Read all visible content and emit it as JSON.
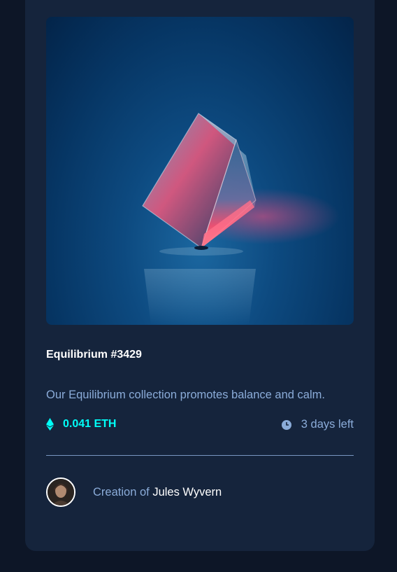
{
  "nft": {
    "title": "Equilibrium #3429",
    "description": "Our Equilibrium collection promotes balance and calm.",
    "price": "0.041 ETH",
    "time_left": "3 days left",
    "image_icon": "crystal-cube-image"
  },
  "creator": {
    "prefix": "Creation of",
    "name": "Jules Wyvern"
  },
  "colors": {
    "page_bg": "#0d1627",
    "card_bg": "#15243c",
    "accent": "#00fff8",
    "soft_blue": "#8bacd9",
    "white": "#ffffff"
  }
}
